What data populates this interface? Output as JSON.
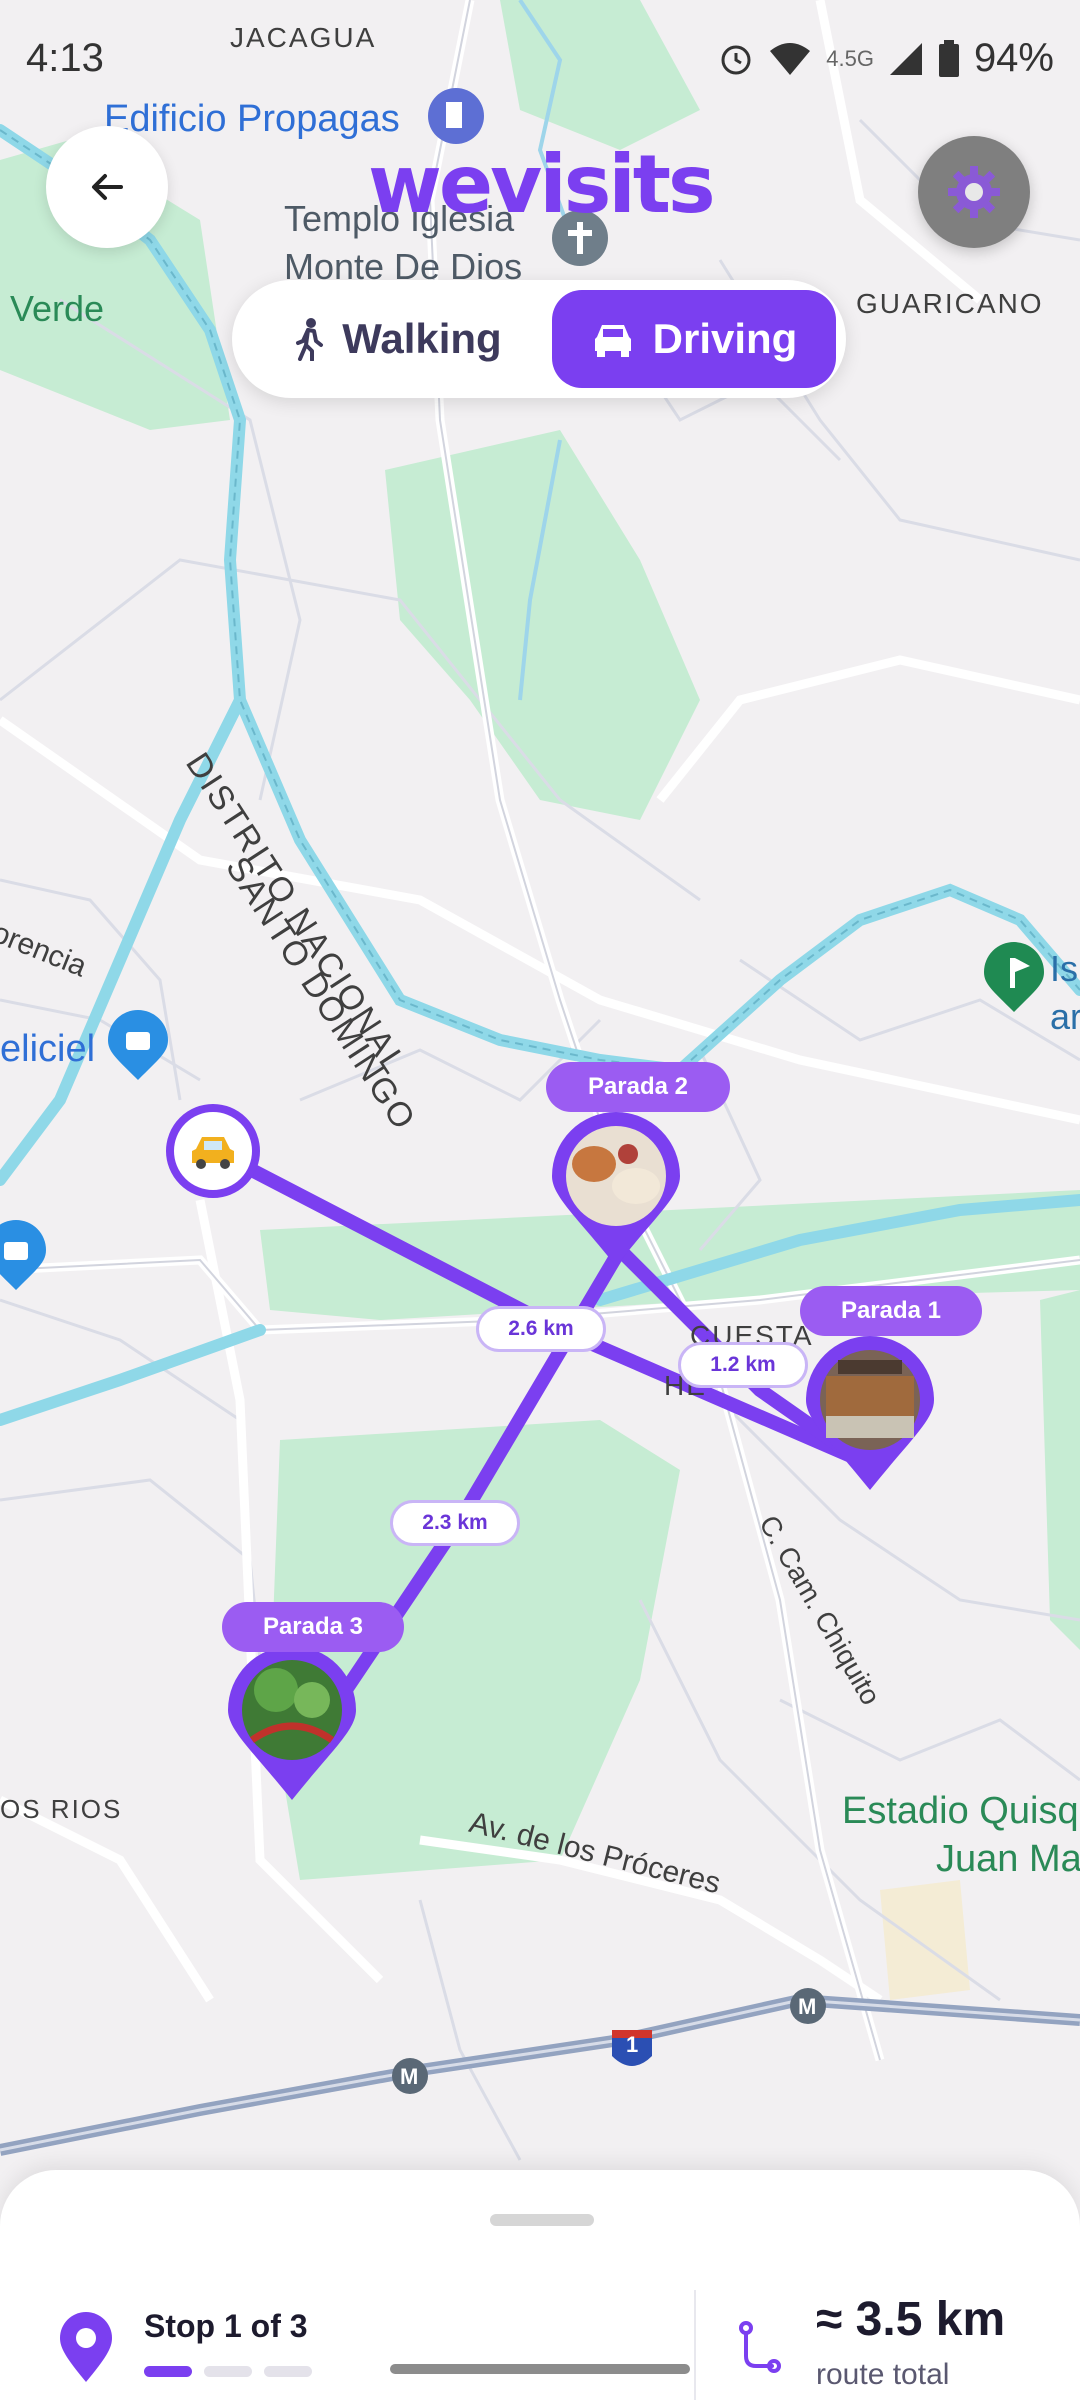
{
  "status_bar": {
    "time": "4:13",
    "network": "4.5G",
    "battery": "94%"
  },
  "header": {
    "brand": "wevisits"
  },
  "mode_toggle": {
    "walking_label": "Walking",
    "driving_label": "Driving",
    "selected": "Driving"
  },
  "map_labels": {
    "jacagua": "JACAGUA",
    "edificio": "Edificio Propagas",
    "templo_1": "Templo Iglesia",
    "templo_2": "Monte De Dios",
    "verde": "Verde",
    "guaricano": "GUARICANO",
    "santo_domingo": "SANTO DOMINGO",
    "distrito": "DISTRITO NACIONAL",
    "prencia": "orencia",
    "deliciel": "eliciel",
    "cuesta": "CUESTA",
    "hermosa": "HE",
    "cam_chiquito": "C. Cam. Chiquito",
    "rios": "OS RIOS",
    "estadio_1": "Estadio Quisq",
    "estadio_2": "Juan Ma",
    "proceres": "Av. de los Próceres",
    "isla_1": "Is",
    "isla_2": "ar",
    "highway": "1",
    "metro": "M"
  },
  "stops": [
    {
      "tag": "Parada 1",
      "photo": "restaurant-building"
    },
    {
      "tag": "Parada 2",
      "photo": "food-plates"
    },
    {
      "tag": "Parada 3",
      "photo": "garden-bridge"
    }
  ],
  "distances": {
    "car_to_stop1": "2.6 km",
    "stop1_to_stop2": "1.2 km",
    "stop2_to_stop3": "2.3 km"
  },
  "bottom_sheet": {
    "stop_status": "Stop 1 of 3",
    "total_value": "≈ 3.5 km",
    "total_label": "route total",
    "current_stop": 1,
    "total_stops": 3
  },
  "colors": {
    "accent": "#7b3ff0",
    "route": "#7b3ff0",
    "tag": "#9b5cf2",
    "park": "#c6ecd3",
    "water": "#8fd8e8"
  },
  "icons": [
    "back-arrow-icon",
    "gear-icon",
    "walking-icon",
    "car-icon",
    "location-pin-icon",
    "route-icon",
    "alarm-icon",
    "wifi-icon",
    "signal-icon",
    "battery-icon",
    "gas-station-icon",
    "church-icon",
    "shopping-icon",
    "golf-icon",
    "metro-icon",
    "highway-shield-icon"
  ]
}
